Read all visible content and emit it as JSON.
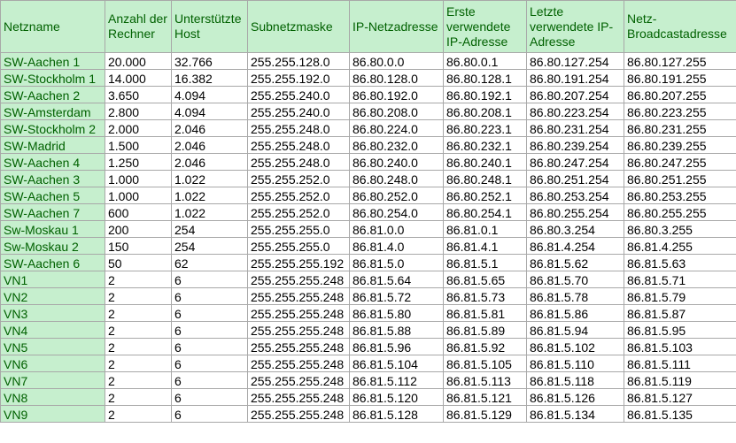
{
  "headers": [
    "Netzname",
    "Anzahl der Rechner",
    "Unterstützte Host",
    "Subnetzmaske",
    "IP-Netzadresse",
    "Erste verwendete IP-Adresse",
    "Letzte verwendete IP-Adresse",
    "Netz-Broadcastadresse"
  ],
  "rows": [
    [
      "SW-Aachen 1",
      "20.000",
      "32.766",
      "255.255.128.0",
      "86.80.0.0",
      "86.80.0.1",
      "86.80.127.254",
      "86.80.127.255"
    ],
    [
      "SW-Stockholm 1",
      "14.000",
      "16.382",
      "255.255.192.0",
      "86.80.128.0",
      "86.80.128.1",
      "86.80.191.254",
      "86.80.191.255"
    ],
    [
      "SW-Aachen 2",
      "3.650",
      "4.094",
      "255.255.240.0",
      "86.80.192.0",
      "86.80.192.1",
      "86.80.207.254",
      "86.80.207.255"
    ],
    [
      "SW-Amsterdam",
      "2.800",
      "4.094",
      "255.255.240.0",
      "86.80.208.0",
      "86.80.208.1",
      "86.80.223.254",
      "86.80.223.255"
    ],
    [
      "SW-Stockholm 2",
      "2.000",
      "2.046",
      "255.255.248.0",
      "86.80.224.0",
      "86.80.223.1",
      "86.80.231.254",
      "86.80.231.255"
    ],
    [
      "SW-Madrid",
      "1.500",
      "2.046",
      "255.255.248.0",
      "86.80.232.0",
      "86.80.232.1",
      "86.80.239.254",
      "86.80.239.255"
    ],
    [
      "SW-Aachen 4",
      "1.250",
      "2.046",
      "255.255.248.0",
      "86.80.240.0",
      "86.80.240.1",
      "86.80.247.254",
      "86.80.247.255"
    ],
    [
      "SW-Aachen 3",
      "1.000",
      "1.022",
      "255.255.252.0",
      "86.80.248.0",
      "86.80.248.1",
      "86.80.251.254",
      "86.80.251.255"
    ],
    [
      "SW-Aachen 5",
      "1.000",
      "1.022",
      "255.255.252.0",
      "86.80.252.0",
      "86.80.252.1",
      "86.80.253.254",
      "86.80.253.255"
    ],
    [
      "SW-Aachen 7",
      "600",
      "1.022",
      "255.255.252.0",
      "86.80.254.0",
      "86.80.254.1",
      "86.80.255.254",
      "86.80.255.255"
    ],
    [
      "Sw-Moskau 1",
      "200",
      "254",
      "255.255.255.0",
      "86.81.0.0",
      "86.81.0.1",
      "86.80.3.254",
      "86.80.3.255"
    ],
    [
      "Sw-Moskau 2",
      "150",
      "254",
      "255.255.255.0",
      "86.81.4.0",
      "86.81.4.1",
      "86.81.4.254",
      "86.81.4.255"
    ],
    [
      "SW-Aachen 6",
      "50",
      "62",
      "255.255.255.192",
      "86.81.5.0",
      "86.81.5.1",
      "86.81.5.62",
      "86.81.5.63"
    ],
    [
      "VN1",
      "2",
      "6",
      "255.255.255.248",
      "86.81.5.64",
      "86.81.5.65",
      "86.81.5.70",
      "86.81.5.71"
    ],
    [
      "VN2",
      "2",
      "6",
      "255.255.255.248",
      "86.81.5.72",
      "86.81.5.73",
      "86.81.5.78",
      "86.81.5.79"
    ],
    [
      "VN3",
      "2",
      "6",
      "255.255.255.248",
      "86.81.5.80",
      "86.81.5.81",
      "86.81.5.86",
      "86.81.5.87"
    ],
    [
      "VN4",
      "2",
      "6",
      "255.255.255.248",
      "86.81.5.88",
      "86.81.5.89",
      "86.81.5.94",
      "86.81.5.95"
    ],
    [
      "VN5",
      "2",
      "6",
      "255.255.255.248",
      "86.81.5.96",
      "86.81.5.92",
      "86.81.5.102",
      "86.81.5.103"
    ],
    [
      "VN6",
      "2",
      "6",
      "255.255.255.248",
      "86.81.5.104",
      "86.81.5.105",
      "86.81.5.110",
      "86.81.5.111"
    ],
    [
      "VN7",
      "2",
      "6",
      "255.255.255.248",
      "86.81.5.112",
      "86.81.5.113",
      "86.81.5.118",
      "86.81.5.119"
    ],
    [
      "VN8",
      "2",
      "6",
      "255.255.255.248",
      "86.81.5.120",
      "86.81.5.121",
      "86.81.5.126",
      "86.81.5.127"
    ],
    [
      "VN9",
      "2",
      "6",
      "255.255.255.248",
      "86.81.5.128",
      "86.81.5.129",
      "86.81.5.134",
      "86.81.5.135"
    ]
  ],
  "colors": {
    "header_fill": "#c6efce",
    "header_text": "#006100",
    "grid_line": "#a8a8a8"
  }
}
